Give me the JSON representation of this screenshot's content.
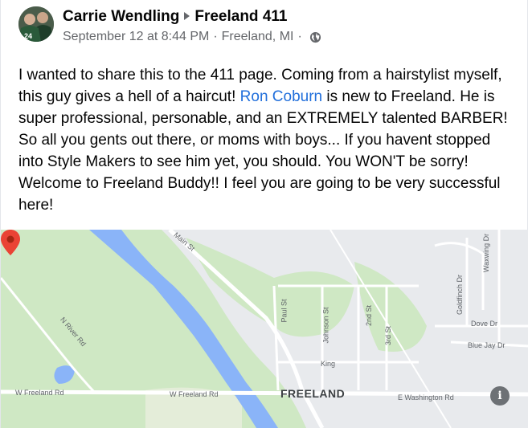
{
  "post": {
    "author": "Carrie Wendling",
    "group": "Freeland 411",
    "timestamp": "September 12 at 8:44 PM",
    "location": "Freeland, MI",
    "separator": "·",
    "audience_icon": "globe-icon",
    "text_before_mention": "I wanted to share this to the 411 page. Coming from a hairstylist myself,  this guy gives a hell of a haircut! ",
    "mention": "Ron Coburn",
    "text_after_mention": "  is new to Freeland.  He is super professional,  personable,  and an EXTREMELY talented BARBER! So all you gents out there, or moms with boys...   If you havent stopped into Style Makers to see him yet, you should. You WON'T be sorry! Welcome to Freeland Buddy!! I feel you are going to be very successful here!"
  },
  "avatar": {
    "jersey_number": "24"
  },
  "map": {
    "labels": {
      "main_st": "Main St",
      "paul_st": "Paul St",
      "johnson_st": "Johnson St",
      "second_st": "2nd St",
      "third_st": "3rd St",
      "goldfinch_dr": "Goldfinch Dr",
      "warwing_dr": "Waxwing Dr",
      "dove_dr": "Dove Dr",
      "blue_jay_dr": "Blue Jay Dr",
      "n_river_rd": "N River Rd",
      "king": "King",
      "w_freeland_rd_1": "W Freeland Rd",
      "w_freeland_rd_2": "W Freeland Rd",
      "town": "FREELAND",
      "e_washington_rd": "E Washington Rd"
    },
    "info_button": "i",
    "colors": {
      "river": "#8ab4f8",
      "park": "#cfe8c4",
      "road": "#ffffff",
      "pin": "#ea4335"
    }
  },
  "colors": {
    "mention": "#216fdb",
    "meta": "#65676b"
  }
}
